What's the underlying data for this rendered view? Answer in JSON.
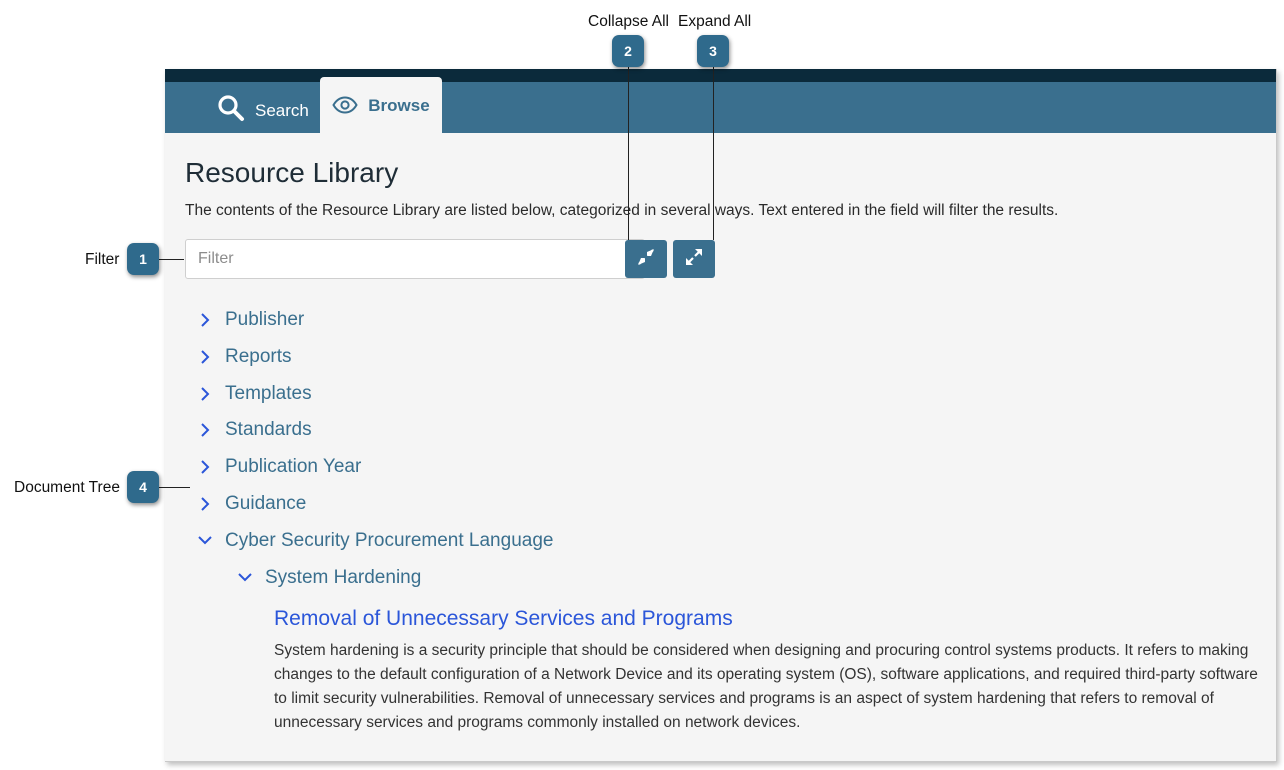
{
  "tabs": {
    "search": {
      "label": "Search",
      "icon": "search-icon"
    },
    "browse": {
      "label": "Browse",
      "icon": "eye-icon",
      "active": true
    }
  },
  "page": {
    "title": "Resource Library",
    "description": "The contents of the Resource Library are listed below, categorized in several ways. Text entered in the field will filter the results."
  },
  "filter": {
    "placeholder": "Filter",
    "value": ""
  },
  "buttons": {
    "collapse_all": {
      "icon": "collapse-arrows-icon"
    },
    "expand_all": {
      "icon": "expand-arrows-icon"
    }
  },
  "tree": {
    "items": [
      {
        "label": "Publisher",
        "expanded": false
      },
      {
        "label": "Reports",
        "expanded": false
      },
      {
        "label": "Templates",
        "expanded": false
      },
      {
        "label": "Standards",
        "expanded": false
      },
      {
        "label": "Publication Year",
        "expanded": false
      },
      {
        "label": "Guidance",
        "expanded": false
      },
      {
        "label": "Cyber Security Procurement Language",
        "expanded": true
      }
    ],
    "subitem": {
      "label": "System Hardening",
      "expanded": true
    },
    "document": {
      "title": "Removal of Unnecessary Services and Programs",
      "body": "System hardening is a security principle that should be considered when designing and procuring control systems products. It refers to making changes to the default configuration of a Network Device and its operating system (OS), software applications, and required third-party software to limit security vulnerabilities. Removal of unnecessary services and programs is an aspect of system hardening that refers to removal of unnecessary services and programs commonly installed on network devices."
    }
  },
  "callouts": {
    "filter": {
      "number": "1",
      "label": "Filter"
    },
    "collapse_all": {
      "number": "2",
      "label": "Collapse All"
    },
    "expand_all": {
      "number": "3",
      "label": "Expand All"
    },
    "document_tree": {
      "number": "4",
      "label": "Document Tree"
    }
  },
  "colors": {
    "header_bar": "#0b2a3b",
    "tab_bar": "#3a6f8e",
    "link": "#3a6f8e",
    "document_link": "#2b56d9",
    "badge": "#2f6a8c",
    "background": "#f5f5f5"
  }
}
